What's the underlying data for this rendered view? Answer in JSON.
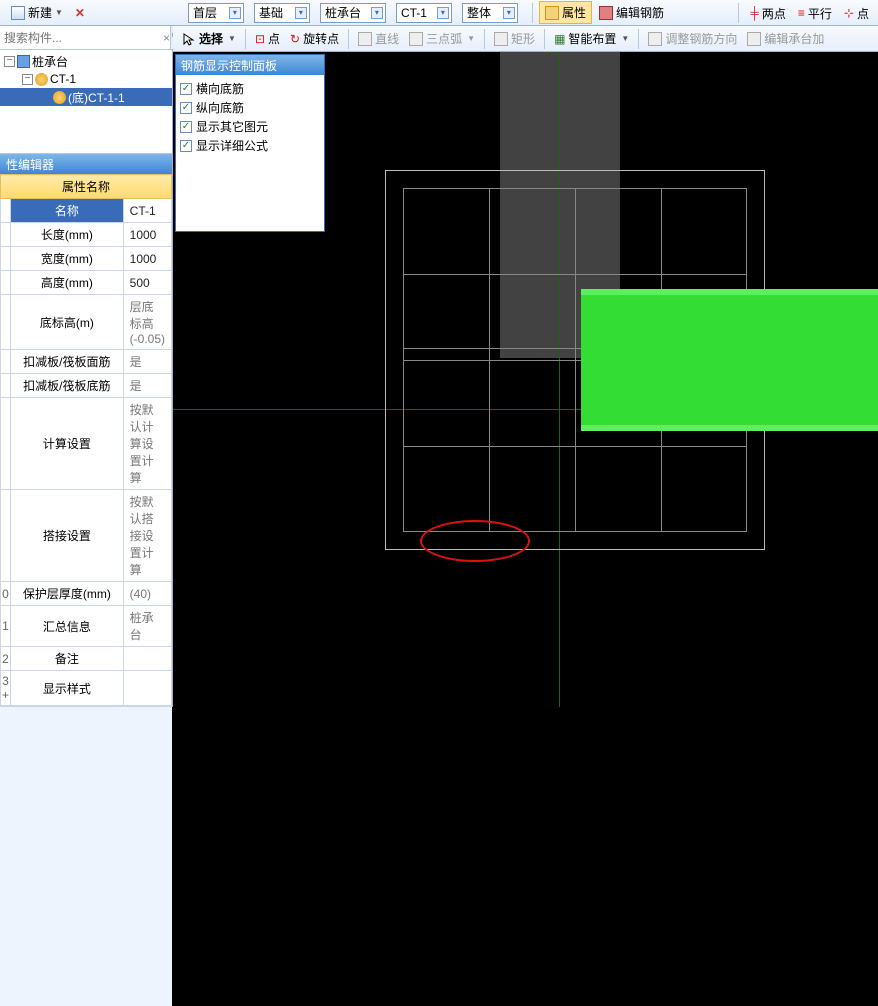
{
  "toolbar1": {
    "new_label": "新建",
    "combos": {
      "floor": "首层",
      "category": "基础",
      "subcategory": "桩承台",
      "element": "CT-1",
      "view": "整体"
    },
    "property_btn": "属性",
    "edit_rebar_btn": "编辑钢筋"
  },
  "toolbar1_right": {
    "two_point": "两点",
    "parallel": "平行",
    "point_more": "点"
  },
  "toolbar2": {
    "select": "选择",
    "point": "点",
    "rotate_point": "旋转点",
    "line": "直线",
    "three_arc": "三点弧",
    "rect": "矩形",
    "smart_layout": "智能布置",
    "adjust_rebar_dir": "调整钢筋方向",
    "edit_cap_add": "编辑承台加"
  },
  "search": {
    "placeholder": "搜索构件..."
  },
  "tree": {
    "root": "桩承台",
    "l1": "CT-1",
    "l2": "(底)CT-1-1"
  },
  "editor_title": "性编辑器",
  "prop": {
    "header_name": "属性名称",
    "rows": [
      {
        "n": "",
        "k": "名称",
        "v": "CT-1",
        "hl": true
      },
      {
        "n": "",
        "k": "长度(mm)",
        "v": "1000"
      },
      {
        "n": "",
        "k": "宽度(mm)",
        "v": "1000"
      },
      {
        "n": "",
        "k": "高度(mm)",
        "v": "500"
      },
      {
        "n": "",
        "k": "底标高(m)",
        "v": "层底标高(-0.05)",
        "gray": true
      },
      {
        "n": "",
        "k": "扣减板/筏板面筋",
        "v": "是",
        "gray": true
      },
      {
        "n": "",
        "k": "扣减板/筏板底筋",
        "v": "是",
        "gray": true
      },
      {
        "n": "",
        "k": "计算设置",
        "v": "按默认计算设置计算",
        "gray": true
      },
      {
        "n": "",
        "k": "搭接设置",
        "v": "按默认搭接设置计算",
        "gray": true
      },
      {
        "n": "0",
        "k": "保护层厚度(mm)",
        "v": "(40)",
        "gray": true
      },
      {
        "n": "1",
        "k": "汇总信息",
        "v": "桩承台",
        "gray": true
      },
      {
        "n": "2",
        "k": "备注",
        "v": ""
      },
      {
        "n": "3 +",
        "k": "显示样式",
        "v": ""
      }
    ]
  },
  "float_panel": {
    "title": "钢筋显示控制面板",
    "items": [
      "横向底筋",
      "纵向底筋",
      "显示其它图元",
      "显示详细公式"
    ]
  }
}
